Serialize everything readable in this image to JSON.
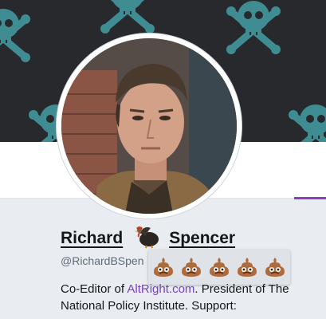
{
  "profile": {
    "name_first": "Richard",
    "name_last": "Spencer",
    "handle": "@RichardBSpen",
    "bio_before": "Co-Editor of ",
    "bio_link": "AltRight.com",
    "bio_after": ". President of The National Policy Institute. Support:",
    "emoji_overlay": [
      "pile-of-poo",
      "pile-of-poo",
      "pile-of-poo",
      "pile-of-poo",
      "pile-of-poo"
    ],
    "name_emoji": "turkey"
  },
  "colors": {
    "banner_bg": "#28292d",
    "skull_pattern": "#3f8c93",
    "link": "#7b3fc1",
    "accent": "#8b3fbf"
  }
}
